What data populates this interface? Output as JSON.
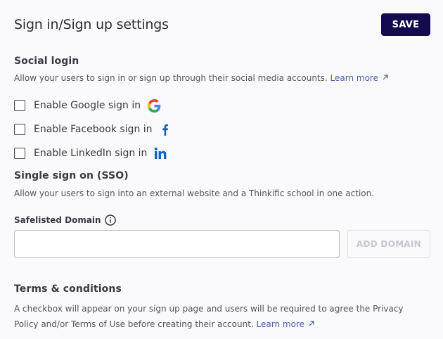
{
  "header": {
    "title": "Sign in/Sign up settings",
    "save_label": "SAVE",
    "save_bg": "#130a4f"
  },
  "social_login": {
    "title": "Social login",
    "description": "Allow your users to sign in or sign up through their social media accounts.",
    "learn_more": "Learn more",
    "options": [
      {
        "label": "Enable Google sign in",
        "icon": "google-icon",
        "checked": false
      },
      {
        "label": "Enable Facebook sign in",
        "icon": "facebook-icon",
        "checked": false
      },
      {
        "label": "Enable LinkedIn sign in",
        "icon": "linkedin-icon",
        "checked": false
      }
    ]
  },
  "sso": {
    "title": "Single sign on (SSO)",
    "description": "Allow your users to sign into an external website and a Thinkific school in one action.",
    "field_label": "Safelisted Domain",
    "domain_value": "",
    "add_button": "ADD DOMAIN"
  },
  "terms": {
    "title": "Terms & conditions",
    "description": "A checkbox will appear on your sign up page and users will be required to agree the Privacy Policy and/or Terms of Use before creating their account.",
    "learn_more": "Learn more"
  },
  "colors": {
    "accent": "#130a4f",
    "link": "#4d5ea0",
    "facebook": "#1d5fb8",
    "linkedin": "#0a66c2"
  }
}
